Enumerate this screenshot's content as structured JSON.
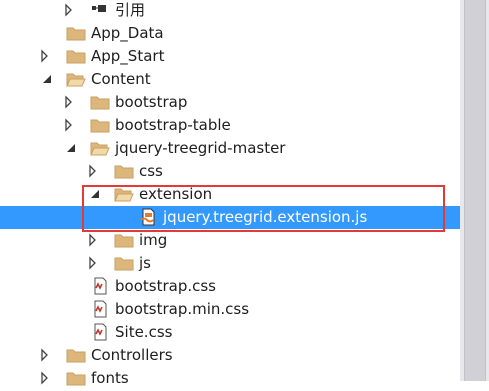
{
  "tree": {
    "items": [
      {
        "label": "引用",
        "icon": "references-icon",
        "expander": "collapsed"
      },
      {
        "label": "App_Data",
        "icon": "folder-icon",
        "expander": "none"
      },
      {
        "label": "App_Start",
        "icon": "folder-icon",
        "expander": "collapsed"
      },
      {
        "label": "Content",
        "icon": "folder-open-icon",
        "expander": "expanded"
      },
      {
        "label": "bootstrap",
        "icon": "folder-icon",
        "expander": "collapsed"
      },
      {
        "label": "bootstrap-table",
        "icon": "folder-icon",
        "expander": "collapsed"
      },
      {
        "label": "jquery-treegrid-master",
        "icon": "folder-open-icon",
        "expander": "expanded"
      },
      {
        "label": "css",
        "icon": "folder-icon",
        "expander": "collapsed"
      },
      {
        "label": "extension",
        "icon": "folder-open-icon",
        "expander": "expanded"
      },
      {
        "label": "jquery.treegrid.extension.js",
        "icon": "js-file-icon",
        "expander": "none",
        "selected": true
      },
      {
        "label": "img",
        "icon": "folder-icon",
        "expander": "collapsed"
      },
      {
        "label": "js",
        "icon": "folder-icon",
        "expander": "collapsed"
      },
      {
        "label": "bootstrap.css",
        "icon": "css-file-icon",
        "expander": "none"
      },
      {
        "label": "bootstrap.min.css",
        "icon": "css-file-icon",
        "expander": "none"
      },
      {
        "label": "Site.css",
        "icon": "css-file-icon",
        "expander": "none"
      },
      {
        "label": "Controllers",
        "icon": "folder-icon",
        "expander": "collapsed"
      },
      {
        "label": "fonts",
        "icon": "folder-icon",
        "expander": "collapsed"
      }
    ]
  },
  "colors": {
    "selection": "#3399ff",
    "highlight_border": "#e53935",
    "folder": "#dcb67a"
  }
}
